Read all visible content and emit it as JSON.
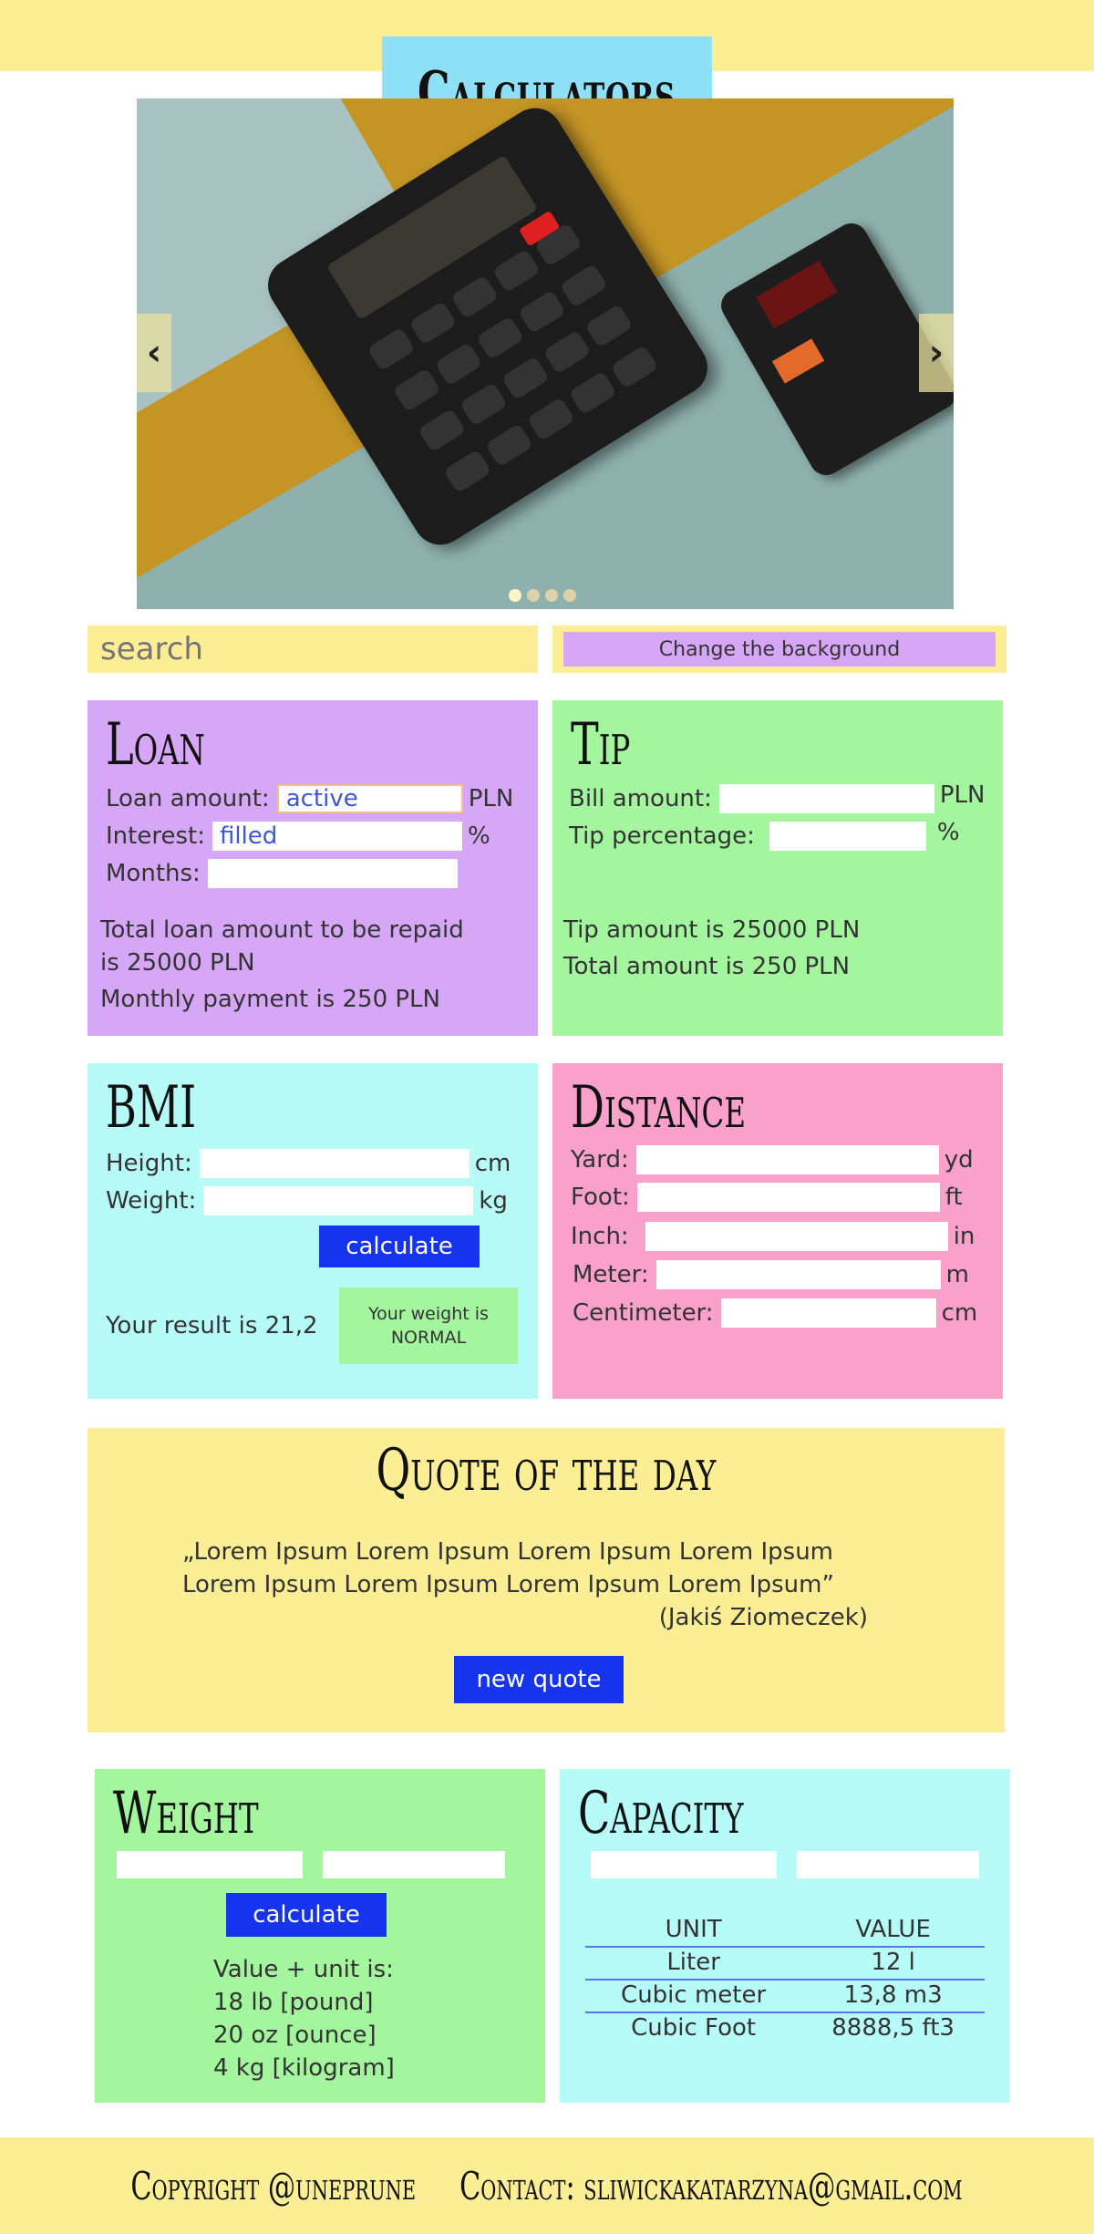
{
  "header": {
    "title": "Calculators"
  },
  "carousel": {
    "prev_icon": "chevron-left-icon",
    "next_icon": "chevron-right-icon",
    "slide_count": 4,
    "active_slide": 1
  },
  "toolbar": {
    "search_placeholder": "search",
    "change_bg_label": "Change the background"
  },
  "loan": {
    "title": "Loan",
    "amount_label": "Loan amount:",
    "amount_value": "active",
    "amount_unit": "PLN",
    "interest_label": "Interest:",
    "interest_value": "filled",
    "interest_unit": "%",
    "months_label": "Months:",
    "total_line1": "Total loan amount to be repaid",
    "total_line2": "is 25000 PLN",
    "monthly": "Monthly payment is 250 PLN"
  },
  "tip": {
    "title": "Tip",
    "bill_label": "Bill amount:",
    "bill_unit": "PLN",
    "pct_label": "Tip percentage:",
    "pct_unit": "%",
    "tip_amount": "Tip amount is 25000 PLN",
    "total_amount": "Total amount is 250 PLN"
  },
  "bmi": {
    "title": "BMI",
    "height_label": "Height:",
    "height_unit": "cm",
    "weight_label": "Weight:",
    "weight_unit": "kg",
    "button": "calculate",
    "result": "Your result is 21,2",
    "badge_line1": "Your weight is",
    "badge_line2": "NORMAL"
  },
  "distance": {
    "title": "Distance",
    "yard_label": "Yard:",
    "yard_unit": "yd",
    "foot_label": "Foot:",
    "foot_unit": "ft",
    "inch_label": "Inch:",
    "inch_unit": "in",
    "meter_label": "Meter:",
    "meter_unit": "m",
    "cm_label": "Centimeter:",
    "cm_unit": "cm"
  },
  "quote": {
    "title": "Quote of the day",
    "line1": "„Lorem Ipsum Lorem Ipsum Lorem Ipsum Lorem Ipsum",
    "line2": "Lorem Ipsum Lorem Ipsum Lorem Ipsum Lorem Ipsum”",
    "author": "(Jakiś Ziomeczek)",
    "button": "new quote"
  },
  "weight": {
    "title": "Weight",
    "button": "calculate",
    "result_label": "Value + unit is:",
    "results": [
      "18 lb [pound]",
      "20 oz [ounce]",
      "4 kg [kilogram]"
    ]
  },
  "capacity": {
    "title": "Capacity",
    "headers": [
      "UNIT",
      "VALUE"
    ],
    "rows": [
      [
        "Liter",
        "12 l"
      ],
      [
        "Cubic meter",
        "13,8 m3"
      ],
      [
        "Cubic Foot",
        "8888,5 ft3"
      ]
    ]
  },
  "footer": {
    "text": "Copyright @uneprune     Contact: sliwickakatarzyna@gmail.com"
  },
  "colors": {
    "yellow": "#fbee95",
    "purple": "#d6a7f7",
    "green": "#a3f59e",
    "cyan": "#b7fbf8",
    "pink": "#f9a1cb",
    "blue_button": "#1633ee",
    "title_bg": "#8ee0f6"
  }
}
